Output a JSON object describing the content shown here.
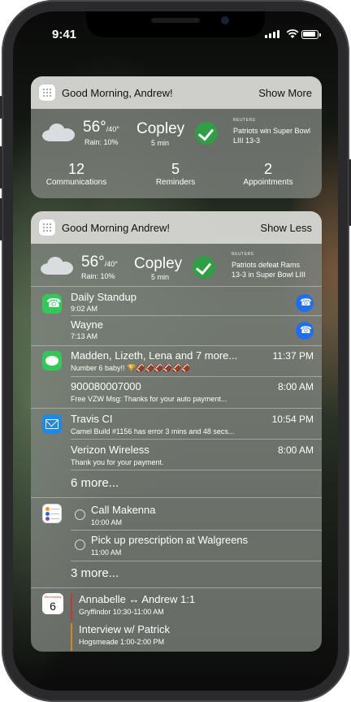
{
  "status": {
    "time": "9:41"
  },
  "colors": {
    "accent_green": "#2f9e44",
    "call_blue": "#1e6ff0",
    "event_red": "#c0392b",
    "event_orange": "#d08b1c"
  },
  "widget1": {
    "title": "Good Morning, Andrew!",
    "action": "Show More",
    "weather": {
      "icon": "cloud-icon",
      "temp": "56°",
      "low": "/40°",
      "rain": "Rain: 10%"
    },
    "commute": {
      "place": "Copley",
      "eta": "5 min"
    },
    "news": {
      "source": "REUTERS",
      "headline_line1": "Patriots win Super Bowl",
      "headline_line2": "LIII 13-3"
    },
    "counts": [
      {
        "value": "12",
        "label": "Communications"
      },
      {
        "value": "5",
        "label": "Reminders"
      },
      {
        "value": "2",
        "label": "Appointments"
      }
    ]
  },
  "widget2": {
    "title": "Good Morning Andrew!",
    "action": "Show Less",
    "weather": {
      "icon": "cloud-icon",
      "temp": "56°",
      "low": "/40°",
      "rain": "Rain: 10%"
    },
    "commute": {
      "place": "Copley",
      "eta": "5 min"
    },
    "news": {
      "source": "REUTERS",
      "headline_line1": "Patriots defeat Rams",
      "headline_line2": "13-3 in Super Bowl LIII"
    },
    "calls": [
      {
        "name": "Daily Standup",
        "time": "9:02 AM"
      },
      {
        "name": "Wayne",
        "time": "7:13 AM"
      }
    ],
    "messages": [
      {
        "sender": "Madden, Lizeth, Lena and 7 more...",
        "time": "11:37 PM",
        "preview": "Number 6 baby!! 🏆🏈🏈🏈🏈🏈🏈"
      },
      {
        "sender": "900080007000",
        "time": "8:00 AM",
        "preview": "Free VZW Msg: Thanks for your auto payment..."
      }
    ],
    "mails": [
      {
        "sender": "Travis CI",
        "time": "10:54 PM",
        "preview": "Camel Build #1156 has error 3 mins and 48 secs..."
      },
      {
        "sender": "Verizon Wireless",
        "time": "8:00 AM",
        "preview": "Thank you for your payment."
      }
    ],
    "mail_more": "6 more...",
    "reminders": [
      {
        "title": "Call Makenna",
        "time": "10:00 AM"
      },
      {
        "title": "Pick up prescription at Walgreens",
        "time": "11:00 AM"
      }
    ],
    "reminder_more": "3 more...",
    "calendar": {
      "weekday": "Wednesday",
      "day": "6"
    },
    "events": [
      {
        "title": "Annabelle ↔ Andrew 1:1",
        "detail": "Gryffindor 10:30-11:00 AM"
      },
      {
        "title": "Interview w/ Patrick",
        "detail": "Hogsmeade 1:00-2:00 PM"
      }
    ]
  }
}
